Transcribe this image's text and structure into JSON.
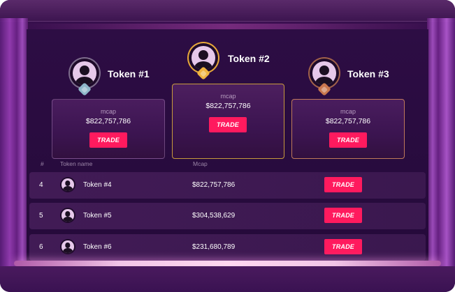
{
  "podium": [
    {
      "rank": 1,
      "name": "Token #1",
      "mcap_label": "mcap",
      "mcap": "$822,757,786",
      "trade_label": "TRADE",
      "badge_color": "#8fb8c9"
    },
    {
      "rank": 2,
      "name": "Token #2",
      "mcap_label": "mcap",
      "mcap": "$822,757,786",
      "trade_label": "TRADE",
      "badge_color": "#f2b440"
    },
    {
      "rank": 3,
      "name": "Token #3",
      "mcap_label": "mcap",
      "mcap": "$822,757,786",
      "trade_label": "TRADE",
      "badge_color": "#c9784f"
    }
  ],
  "table": {
    "headers": {
      "rank": "#",
      "name": "Token name",
      "mcap": "Mcap"
    },
    "rows": [
      {
        "rank": "4",
        "name": "Token #4",
        "mcap": "$822,757,786",
        "trade_label": "TRADE"
      },
      {
        "rank": "5",
        "name": "Token #5",
        "mcap": "$304,538,629",
        "trade_label": "TRADE"
      },
      {
        "rank": "6",
        "name": "Token #6",
        "mcap": "$231,680,789",
        "trade_label": "TRADE"
      }
    ]
  },
  "icons": {
    "avatar": "user-silhouette-icon",
    "badge": "medal-badge-icon"
  },
  "colors": {
    "accent": "#ff1a5e",
    "gold": "#c89b3c",
    "background": "#2a0a40"
  }
}
